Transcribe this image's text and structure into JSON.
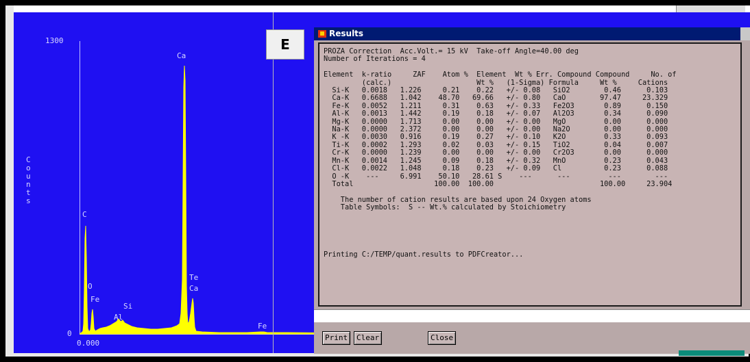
{
  "badge": "E",
  "spectrum": {
    "y_max_label": "1300",
    "y_zero_label": "0",
    "x_start_label": "0.000",
    "y_axis_label": "Counts",
    "peak_labels": {
      "ca_top": "Ca",
      "c": "C",
      "o": "O",
      "fe_low": "Fe",
      "si": "Si",
      "al": "Al",
      "te": "Te",
      "ca_low": "Ca",
      "fe_high": "Fe"
    },
    "trace_color": "#ffff00",
    "background_color": "#1f10f2"
  },
  "results_window": {
    "title": "Results",
    "text_lines": [
      "PROZA Correction  Acc.Volt.= 15 kV  Take-off Angle=40.00 deg",
      "Number of Iterations = 4",
      "",
      "Element  k-ratio     ZAF    Atom %  Element  Wt % Err. Compound Compound     No. of",
      "         (calc.)                    Wt %   (1-Sigma) Formula     Wt %     Cations",
      "  Si-K   0.0018   1.226     0.21    0.22   +/- 0.08   SiO2        0.46      0.103",
      "  Ca-K   0.6688   1.042    48.70   69.66   +/- 0.80   CaO        97.47     23.329",
      "  Fe-K   0.0052   1.211     0.31    0.63   +/- 0.33   Fe2O3       0.89      0.150",
      "  Al-K   0.0013   1.442     0.19    0.18   +/- 0.07   Al2O3       0.34      0.090",
      "  Mg-K   0.0000   1.713     0.00    0.00   +/- 0.00   MgO         0.00      0.000",
      "  Na-K   0.0000   2.372     0.00    0.00   +/- 0.00   Na2O        0.00      0.000",
      "  K -K   0.0030   0.916     0.19    0.27   +/- 0.10   K2O         0.33      0.093",
      "  Ti-K   0.0002   1.293     0.02    0.03   +/- 0.15   TiO2        0.04      0.007",
      "  Cr-K   0.0000   1.239     0.00    0.00   +/- 0.00   Cr2O3       0.00      0.000",
      "  Mn-K   0.0014   1.245     0.09    0.18   +/- 0.32   MnO         0.23      0.043",
      "  Cl-K   0.0022   1.048     0.18    0.23   +/- 0.09   Cl          0.23      0.088",
      "  O -K    ---     6.991    50.10   28.61 S    ---      ---         ---        ---",
      "  Total                   100.00  100.00                         100.00     23.904",
      "",
      "    The number of cation results are based upon 24 Oxygen atoms",
      "    Table Symbols:  S -- Wt.% calculated by Stoichiometry",
      "",
      "",
      "",
      "",
      "",
      "Printing C:/TEMP/quant.results to PDFCreator..."
    ],
    "buttons": {
      "print": "Print",
      "clear": "Clear",
      "close": "Close"
    }
  }
}
